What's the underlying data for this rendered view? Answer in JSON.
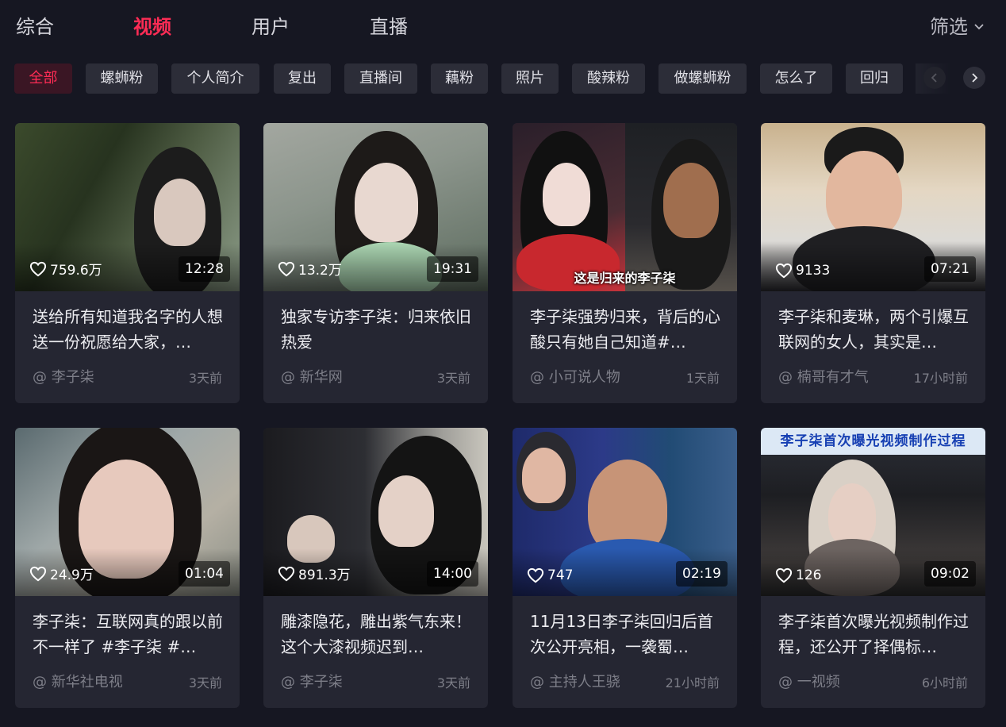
{
  "tabs": [
    "综合",
    "视频",
    "用户",
    "直播"
  ],
  "active_tab": "视频",
  "filter_label": "筛选",
  "chips": [
    "全部",
    "螺蛳粉",
    "个人简介",
    "复出",
    "直播间",
    "藕粉",
    "照片",
    "酸辣粉",
    "做螺蛳粉",
    "怎么了",
    "回归"
  ],
  "active_chip": "全部",
  "colors": {
    "accent": "#fe2c55",
    "background": "#161722",
    "card": "#252632"
  },
  "icons": {
    "like": "heart-icon",
    "filter": "chevron-down-icon",
    "prev": "chevron-left-icon",
    "next": "chevron-right-icon"
  },
  "videos": [
    {
      "likes": "759.6万",
      "duration": "12:28",
      "title": "送给所有知道我名字的人想送一份祝愿给大家，…",
      "author": "@ 李子柒",
      "time": "3天前"
    },
    {
      "likes": "13.2万",
      "duration": "19:31",
      "title": "独家专访李子柒：归来依旧热爱",
      "author": "@ 新华网",
      "time": "3天前"
    },
    {
      "likes": "",
      "duration": "",
      "title": "李子柒强势归来，背后的心酸只有她自己知道#…",
      "author": "@ 小可说人物",
      "time": "1天前",
      "caption": "这是归来的李子柒"
    },
    {
      "likes": "9133",
      "duration": "07:21",
      "title": "李子柒和麦琳，两个引爆互联网的女人，其实是…",
      "author": "@ 楠哥有才气",
      "time": "17小时前"
    },
    {
      "likes": "24.9万",
      "duration": "01:04",
      "title": "李子柒：互联网真的跟以前不一样了 #李子柒 #…",
      "author": "@ 新华社电视",
      "time": "3天前"
    },
    {
      "likes": "891.3万",
      "duration": "14:00",
      "title": "雕漆隐花，雕出紫气东来！ 这个大漆视频迟到…",
      "author": "@ 李子柒",
      "time": "3天前"
    },
    {
      "likes": "747",
      "duration": "02:19",
      "title": "11月13日李子柒回归后首次公开亮相，一袭蜀…",
      "author": "@ 主持人王骁",
      "time": "21小时前"
    },
    {
      "likes": "126",
      "duration": "09:02",
      "title": "李子柒首次曝光视频制作过程，还公开了择偶标…",
      "author": "@ 一视频",
      "time": "6小时前",
      "banner": "李子柒首次曝光视频制作过程"
    }
  ]
}
